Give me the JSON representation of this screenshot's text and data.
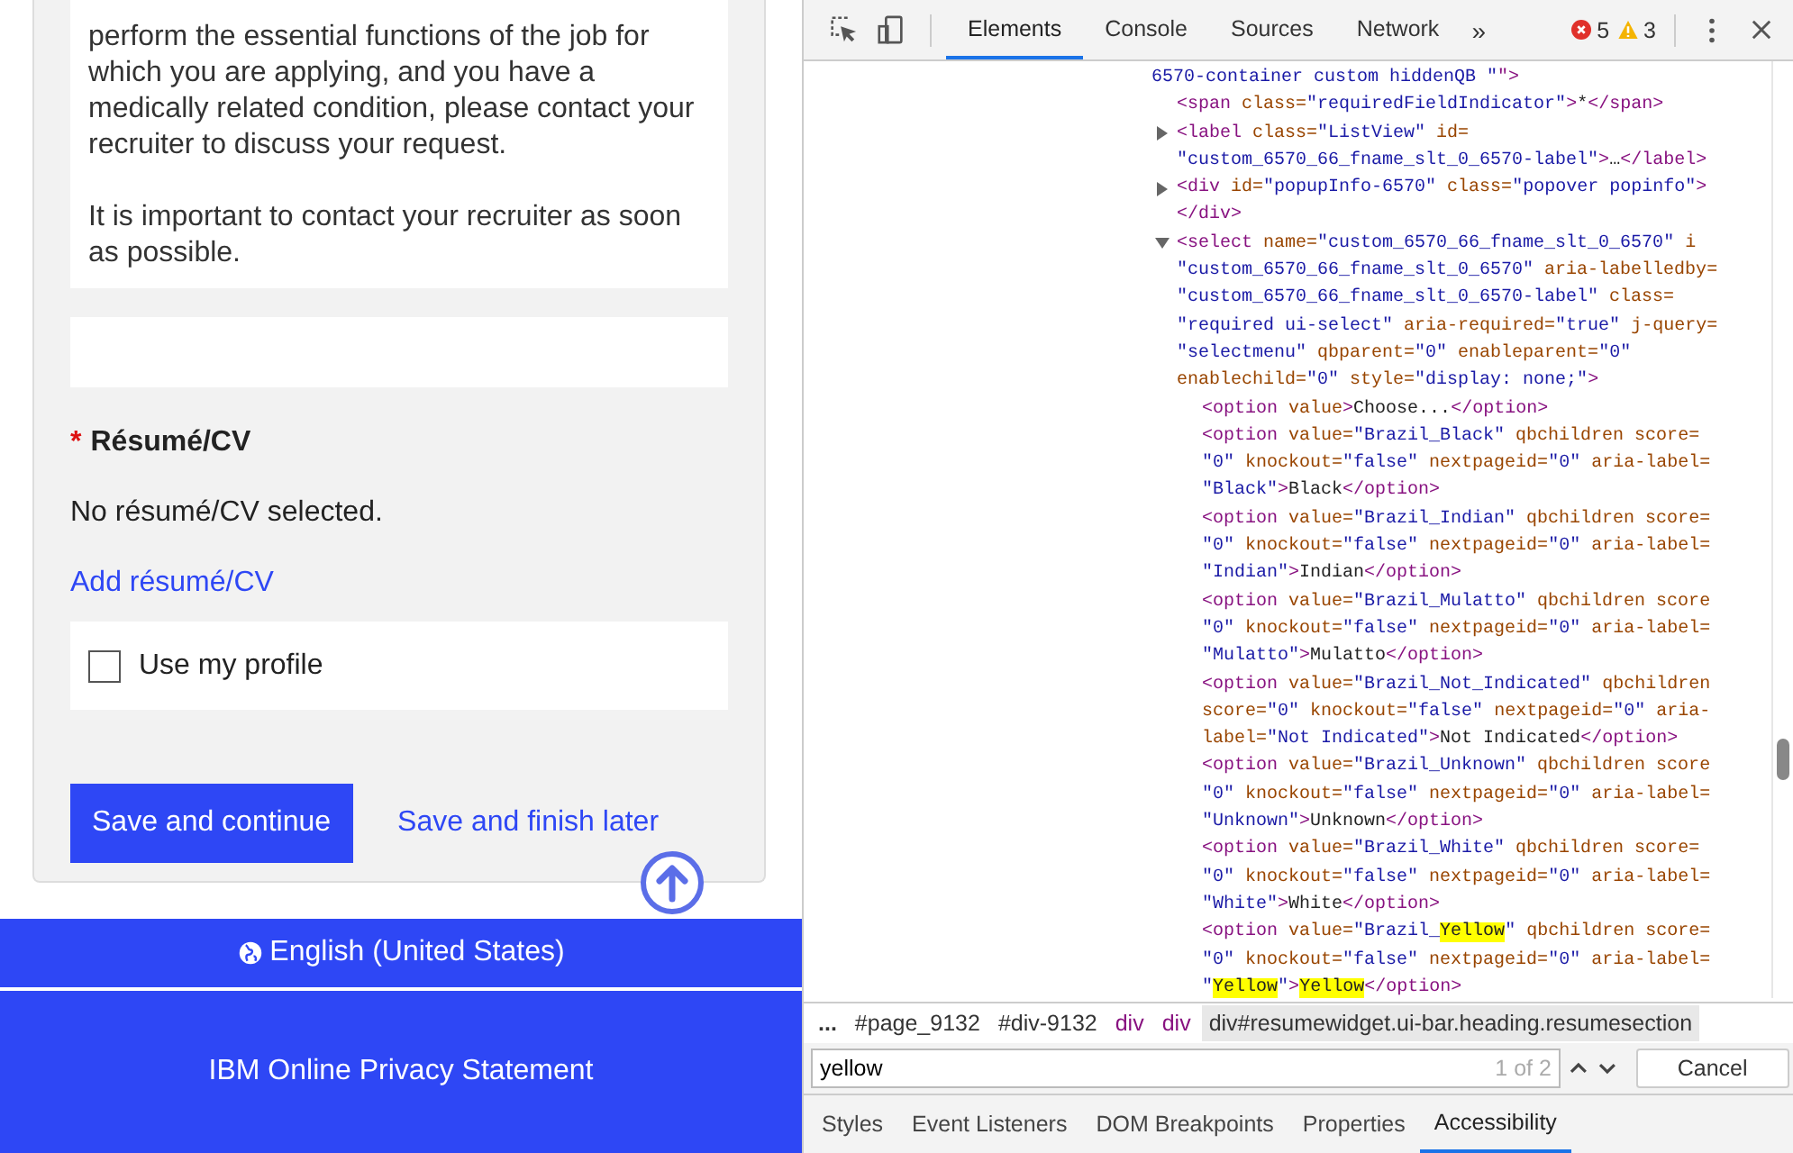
{
  "form": {
    "notice_paragraphs": [
      "perform the essential functions of the job for which you are applying, and you have a medically related condition, please contact your recruiter to discuss your request.",
      "It is important to contact your recruiter as soon as possible."
    ],
    "resume": {
      "required_mark": "*",
      "label": "Résumé/CV",
      "status": "No résumé/CV selected.",
      "add_link": "Add résumé/CV"
    },
    "use_profile": {
      "label": "Use my profile",
      "checked": false
    },
    "buttons": [
      {
        "label": "Save and continue",
        "kind": "primary"
      },
      {
        "label": "Save and finish later",
        "kind": "link"
      }
    ]
  },
  "footer": {
    "language": "English (United States)",
    "privacy_link": "IBM Online Privacy Statement"
  },
  "devtools": {
    "tabs": [
      {
        "label": "Elements",
        "selected": true
      },
      {
        "label": "Console",
        "selected": false
      },
      {
        "label": "Sources",
        "selected": false
      },
      {
        "label": "Network",
        "selected": false
      }
    ],
    "more": "»",
    "errors": "5",
    "warnings": "3",
    "dom_tree": {
      "lines": [
        [
          {
            "kind": "val",
            "text": "6570-container custom hiddenQB \""
          },
          {
            "kind": "tag",
            "text": "\">"
          }
        ]
      ],
      "children": [
        {
          "lines": [
            [
              {
                "kind": "tag",
                "text": "<span"
              },
              {
                "kind": "attr",
                "text": " class="
              },
              {
                "kind": "val",
                "text": "\"requiredFieldIndicator\""
              },
              {
                "kind": "tag",
                "text": ">"
              },
              {
                "kind": "text",
                "text": "*"
              },
              {
                "kind": "tag",
                "text": "</span>"
              }
            ]
          ]
        },
        {
          "expanded": false,
          "lines": [
            [
              {
                "kind": "tag",
                "text": "<label"
              },
              {
                "kind": "attr",
                "text": " class="
              },
              {
                "kind": "val",
                "text": "\"ListView\""
              },
              {
                "kind": "attr",
                "text": " id="
              }
            ],
            [
              {
                "kind": "val",
                "text": "\"custom_6570_66_fname_slt_0_6570-label\""
              },
              {
                "kind": "tag",
                "text": ">"
              },
              {
                "kind": "text",
                "text": "…"
              },
              {
                "kind": "tag",
                "text": "</label>"
              }
            ]
          ]
        },
        {
          "expanded": false,
          "lines": [
            [
              {
                "kind": "tag",
                "text": "<div"
              },
              {
                "kind": "attr",
                "text": " id="
              },
              {
                "kind": "val",
                "text": "\"popupInfo-6570\""
              },
              {
                "kind": "attr",
                "text": " class="
              },
              {
                "kind": "val",
                "text": "\"popover popinfo\""
              },
              {
                "kind": "tag",
                "text": ">"
              }
            ],
            [
              {
                "kind": "tag",
                "text": "</div>"
              }
            ]
          ]
        },
        {
          "expanded": true,
          "lines": [
            [
              {
                "kind": "tag",
                "text": "<select"
              },
              {
                "kind": "attr",
                "text": " name="
              },
              {
                "kind": "val",
                "text": "\"custom_6570_66_fname_slt_0_6570\""
              },
              {
                "kind": "attr",
                "text": " i"
              }
            ],
            [
              {
                "kind": "val",
                "text": "\"custom_6570_66_fname_slt_0_6570\""
              },
              {
                "kind": "attr",
                "text": " aria-labelledby="
              }
            ],
            [
              {
                "kind": "val",
                "text": "\"custom_6570_66_fname_slt_0_6570-label\""
              },
              {
                "kind": "attr",
                "text": " class="
              }
            ],
            [
              {
                "kind": "val",
                "text": "\"required ui-select\""
              },
              {
                "kind": "attr",
                "text": " aria-required="
              },
              {
                "kind": "val",
                "text": "\"true\""
              },
              {
                "kind": "attr",
                "text": " j-query="
              }
            ],
            [
              {
                "kind": "val",
                "text": "\"selectmenu\""
              },
              {
                "kind": "attr",
                "text": " qbparent="
              },
              {
                "kind": "val",
                "text": "\"0\""
              },
              {
                "kind": "attr",
                "text": " enableparent="
              },
              {
                "kind": "val",
                "text": "\"0\""
              }
            ],
            [
              {
                "kind": "attr",
                "text": "enablechild="
              },
              {
                "kind": "val",
                "text": "\"0\""
              },
              {
                "kind": "attr",
                "text": " style="
              },
              {
                "kind": "val",
                "text": "\"display: none;\""
              },
              {
                "kind": "tag",
                "text": ">"
              }
            ]
          ],
          "children": [
            {
              "lines": [
                [
                  {
                    "kind": "tag",
                    "text": "<option"
                  },
                  {
                    "kind": "attr",
                    "text": " value"
                  },
                  {
                    "kind": "tag",
                    "text": ">"
                  },
                  {
                    "kind": "text",
                    "text": "Choose..."
                  },
                  {
                    "kind": "tag",
                    "text": "</option>"
                  }
                ]
              ]
            },
            {
              "lines": [
                [
                  {
                    "kind": "tag",
                    "text": "<option"
                  },
                  {
                    "kind": "attr",
                    "text": " value="
                  },
                  {
                    "kind": "val",
                    "text": "\"Brazil_Black\""
                  },
                  {
                    "kind": "attr",
                    "text": " qbchildren score="
                  }
                ],
                [
                  {
                    "kind": "val",
                    "text": "\"0\""
                  },
                  {
                    "kind": "attr",
                    "text": " knockout="
                  },
                  {
                    "kind": "val",
                    "text": "\"false\""
                  },
                  {
                    "kind": "attr",
                    "text": " nextpageid="
                  },
                  {
                    "kind": "val",
                    "text": "\"0\""
                  },
                  {
                    "kind": "attr",
                    "text": " aria-label="
                  }
                ],
                [
                  {
                    "kind": "val",
                    "text": "\"Black\""
                  },
                  {
                    "kind": "tag",
                    "text": ">"
                  },
                  {
                    "kind": "text",
                    "text": "Black"
                  },
                  {
                    "kind": "tag",
                    "text": "</option>"
                  }
                ]
              ]
            },
            {
              "lines": [
                [
                  {
                    "kind": "tag",
                    "text": "<option"
                  },
                  {
                    "kind": "attr",
                    "text": " value="
                  },
                  {
                    "kind": "val",
                    "text": "\"Brazil_Indian\""
                  },
                  {
                    "kind": "attr",
                    "text": " qbchildren score="
                  }
                ],
                [
                  {
                    "kind": "val",
                    "text": "\"0\""
                  },
                  {
                    "kind": "attr",
                    "text": " knockout="
                  },
                  {
                    "kind": "val",
                    "text": "\"false\""
                  },
                  {
                    "kind": "attr",
                    "text": " nextpageid="
                  },
                  {
                    "kind": "val",
                    "text": "\"0\""
                  },
                  {
                    "kind": "attr",
                    "text": " aria-label="
                  }
                ],
                [
                  {
                    "kind": "val",
                    "text": "\"Indian\""
                  },
                  {
                    "kind": "tag",
                    "text": ">"
                  },
                  {
                    "kind": "text",
                    "text": "Indian"
                  },
                  {
                    "kind": "tag",
                    "text": "</option>"
                  }
                ]
              ]
            },
            {
              "lines": [
                [
                  {
                    "kind": "tag",
                    "text": "<option"
                  },
                  {
                    "kind": "attr",
                    "text": " value="
                  },
                  {
                    "kind": "val",
                    "text": "\"Brazil_Mulatto\""
                  },
                  {
                    "kind": "attr",
                    "text": " qbchildren score"
                  }
                ],
                [
                  {
                    "kind": "val",
                    "text": "\"0\""
                  },
                  {
                    "kind": "attr",
                    "text": " knockout="
                  },
                  {
                    "kind": "val",
                    "text": "\"false\""
                  },
                  {
                    "kind": "attr",
                    "text": " nextpageid="
                  },
                  {
                    "kind": "val",
                    "text": "\"0\""
                  },
                  {
                    "kind": "attr",
                    "text": " aria-label="
                  }
                ],
                [
                  {
                    "kind": "val",
                    "text": "\"Mulatto\""
                  },
                  {
                    "kind": "tag",
                    "text": ">"
                  },
                  {
                    "kind": "text",
                    "text": "Mulatto"
                  },
                  {
                    "kind": "tag",
                    "text": "</option>"
                  }
                ]
              ]
            },
            {
              "lines": [
                [
                  {
                    "kind": "tag",
                    "text": "<option"
                  },
                  {
                    "kind": "attr",
                    "text": " value="
                  },
                  {
                    "kind": "val",
                    "text": "\"Brazil_Not_Indicated\""
                  },
                  {
                    "kind": "attr",
                    "text": " qbchildren"
                  }
                ],
                [
                  {
                    "kind": "attr",
                    "text": "score="
                  },
                  {
                    "kind": "val",
                    "text": "\"0\""
                  },
                  {
                    "kind": "attr",
                    "text": " knockout="
                  },
                  {
                    "kind": "val",
                    "text": "\"false\""
                  },
                  {
                    "kind": "attr",
                    "text": " nextpageid="
                  },
                  {
                    "kind": "val",
                    "text": "\"0\""
                  },
                  {
                    "kind": "attr",
                    "text": " aria-"
                  }
                ],
                [
                  {
                    "kind": "attr",
                    "text": "label="
                  },
                  {
                    "kind": "val",
                    "text": "\"Not Indicated\""
                  },
                  {
                    "kind": "tag",
                    "text": ">"
                  },
                  {
                    "kind": "text",
                    "text": "Not Indicated"
                  },
                  {
                    "kind": "tag",
                    "text": "</option>"
                  }
                ]
              ]
            },
            {
              "lines": [
                [
                  {
                    "kind": "tag",
                    "text": "<option"
                  },
                  {
                    "kind": "attr",
                    "text": " value="
                  },
                  {
                    "kind": "val",
                    "text": "\"Brazil_Unknown\""
                  },
                  {
                    "kind": "attr",
                    "text": " qbchildren score"
                  }
                ],
                [
                  {
                    "kind": "val",
                    "text": "\"0\""
                  },
                  {
                    "kind": "attr",
                    "text": " knockout="
                  },
                  {
                    "kind": "val",
                    "text": "\"false\""
                  },
                  {
                    "kind": "attr",
                    "text": " nextpageid="
                  },
                  {
                    "kind": "val",
                    "text": "\"0\""
                  },
                  {
                    "kind": "attr",
                    "text": " aria-label="
                  }
                ],
                [
                  {
                    "kind": "val",
                    "text": "\"Unknown\""
                  },
                  {
                    "kind": "tag",
                    "text": ">"
                  },
                  {
                    "kind": "text",
                    "text": "Unknown"
                  },
                  {
                    "kind": "tag",
                    "text": "</option>"
                  }
                ]
              ]
            },
            {
              "lines": [
                [
                  {
                    "kind": "tag",
                    "text": "<option"
                  },
                  {
                    "kind": "attr",
                    "text": " value="
                  },
                  {
                    "kind": "val",
                    "text": "\"Brazil_White\""
                  },
                  {
                    "kind": "attr",
                    "text": " qbchildren score="
                  }
                ],
                [
                  {
                    "kind": "val",
                    "text": "\"0\""
                  },
                  {
                    "kind": "attr",
                    "text": " knockout="
                  },
                  {
                    "kind": "val",
                    "text": "\"false\""
                  },
                  {
                    "kind": "attr",
                    "text": " nextpageid="
                  },
                  {
                    "kind": "val",
                    "text": "\"0\""
                  },
                  {
                    "kind": "attr",
                    "text": " aria-label="
                  }
                ],
                [
                  {
                    "kind": "val",
                    "text": "\"White\""
                  },
                  {
                    "kind": "tag",
                    "text": ">"
                  },
                  {
                    "kind": "text",
                    "text": "White"
                  },
                  {
                    "kind": "tag",
                    "text": "</option>"
                  }
                ]
              ]
            },
            {
              "lines": [
                [
                  {
                    "kind": "tag",
                    "text": "<option"
                  },
                  {
                    "kind": "attr",
                    "text": " value="
                  },
                  {
                    "kind": "val",
                    "text": "\"Brazil_"
                  },
                  {
                    "kind": "hit",
                    "text": "Yellow"
                  },
                  {
                    "kind": "val",
                    "text": "\""
                  },
                  {
                    "kind": "attr",
                    "text": " qbchildren score="
                  }
                ],
                [
                  {
                    "kind": "val",
                    "text": "\"0\""
                  },
                  {
                    "kind": "attr",
                    "text": " knockout="
                  },
                  {
                    "kind": "val",
                    "text": "\"false\""
                  },
                  {
                    "kind": "attr",
                    "text": " nextpageid="
                  },
                  {
                    "kind": "val",
                    "text": "\"0\""
                  },
                  {
                    "kind": "attr",
                    "text": " aria-label="
                  }
                ],
                [
                  {
                    "kind": "val",
                    "text": "\""
                  },
                  {
                    "kind": "hit",
                    "text": "Yellow"
                  },
                  {
                    "kind": "val",
                    "text": "\""
                  },
                  {
                    "kind": "tag",
                    "text": ">"
                  },
                  {
                    "kind": "hit",
                    "text": "Yellow"
                  },
                  {
                    "kind": "tag",
                    "text": "</option>"
                  }
                ]
              ]
            }
          ]
        }
      ]
    },
    "breadcrumbs": [
      {
        "label": "...",
        "kind": "more",
        "selected": false
      },
      {
        "label": "#page_9132",
        "kind": "id",
        "selected": false
      },
      {
        "label": "#div-9132",
        "kind": "id",
        "selected": false
      },
      {
        "label": "div",
        "kind": "tag",
        "selected": false
      },
      {
        "label": "div",
        "kind": "tag",
        "selected": false
      },
      {
        "label": "div#resumewidget.ui-bar.heading.resumesection",
        "kind": "id",
        "selected": true
      }
    ],
    "search": {
      "value": "yellow",
      "match_count": "1 of 2"
    },
    "cancel": "Cancel",
    "panel_tabs": [
      {
        "label": "Styles",
        "selected": false
      },
      {
        "label": "Event Listeners",
        "selected": false
      },
      {
        "label": "DOM Breakpoints",
        "selected": false
      },
      {
        "label": "Properties",
        "selected": false
      },
      {
        "label": "Accessibility",
        "selected": true
      }
    ]
  }
}
